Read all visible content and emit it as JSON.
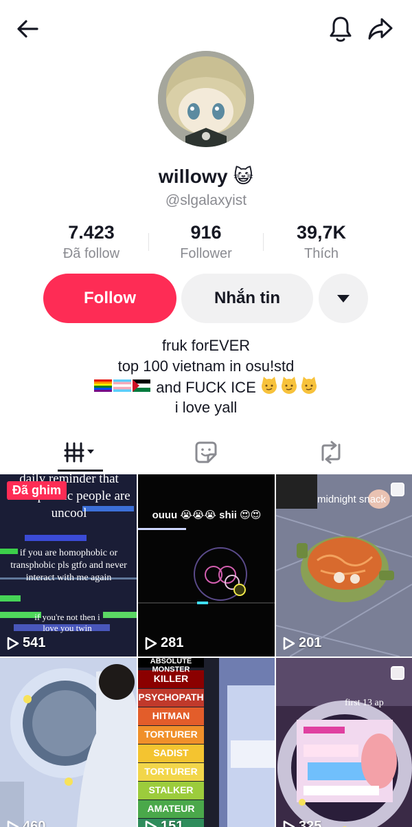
{
  "header": {
    "back_icon": "arrow-left-icon",
    "bell_icon": "bell-icon",
    "share_icon": "share-icon"
  },
  "profile": {
    "display_name": "willowy",
    "name_emoji": "😺",
    "handle": "@slgalaxyist"
  },
  "stats": [
    {
      "value": "7.423",
      "label": "Đã follow"
    },
    {
      "value": "916",
      "label": "Follower"
    },
    {
      "value": "39,7K",
      "label": "Thích"
    }
  ],
  "actions": {
    "follow_label": "Follow",
    "message_label": "Nhắn tin",
    "more_icon": "caret-down-icon"
  },
  "bio": {
    "line1": "fruk forEVER",
    "line2": "top 100 vietnam in osu!std",
    "line3_flags": "🏳️‍🌈🏳️‍⚧️🇵🇸",
    "line3_text": "and FUCK ICE",
    "line3_emoji": "😼😼😼",
    "line4": "i love yall"
  },
  "tabs": {
    "videos_icon": "videos-grid-icon",
    "liked_icon": "sticker-icon",
    "reposts_icon": "repost-icon"
  },
  "videos": [
    {
      "views": "541",
      "pinned_label": "Đã ghim",
      "text_top": "daily reminder that homophobic people are uncool",
      "text_mid": "if you are homophobic or transphobic pls gtfo and never interact with me again",
      "text_bottom": "if you're not then i love you twin"
    },
    {
      "views": "281",
      "caption": "ouuu 😭😭😭 shii 😍😍"
    },
    {
      "views": "201",
      "caption": "midnight snack"
    },
    {
      "views": "460"
    },
    {
      "views": "151",
      "tiers": [
        "ABSOLUTE MONSTER",
        "KILLER",
        "PSYCHOPATH",
        "HITMAN",
        "TORTURER",
        "SADIST",
        "TORTURER",
        "STALKER",
        "AMATEUR"
      ]
    },
    {
      "views": "325",
      "caption": "first 13 ap"
    }
  ],
  "colors": {
    "accent": "#fe2c55",
    "muted_text": "#8a8b91",
    "button_gray": "#f1f1f2"
  }
}
